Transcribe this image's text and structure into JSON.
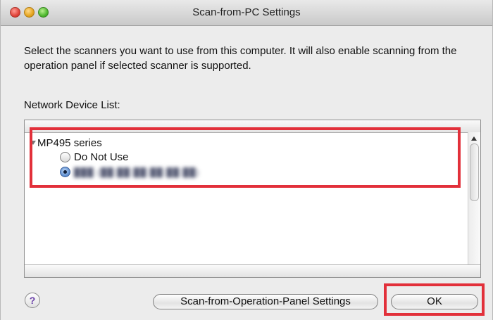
{
  "window": {
    "title": "Scan-from-PC Settings"
  },
  "description": "Select the scanners you want to use from this computer. It will also enable scanning from the operation panel if selected scanner is supported.",
  "list": {
    "label": "Network Device List:",
    "device": {
      "name": "MP495 series",
      "options": [
        {
          "label": "Do Not Use",
          "selected": false
        },
        {
          "label": "███ (██:██:██:██:██:██)",
          "selected": true
        }
      ]
    }
  },
  "buttons": {
    "help": "?",
    "scan_from_panel": "Scan-from-Operation-Panel Settings",
    "ok": "OK"
  },
  "colors": {
    "highlight": "#e2303a",
    "window_bg": "#ececec"
  },
  "icons": {
    "expand": "disclosure-triangle-down-icon",
    "help": "help-icon"
  }
}
